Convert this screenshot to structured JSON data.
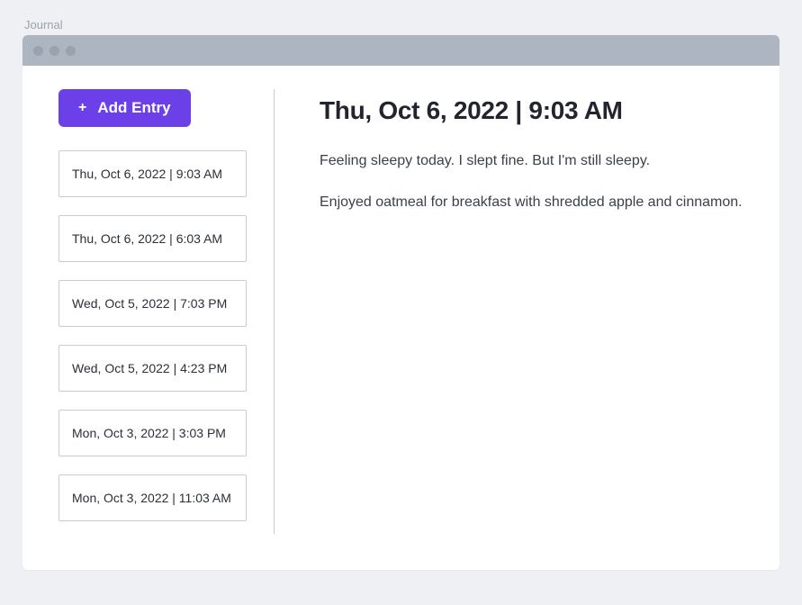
{
  "window": {
    "label": "Journal"
  },
  "sidebar": {
    "add_button_label": "Add Entry",
    "entries": [
      {
        "label": "Thu, Oct 6, 2022 | 9:03 AM"
      },
      {
        "label": "Thu, Oct 6, 2022 | 6:03 AM"
      },
      {
        "label": "Wed, Oct 5, 2022 | 7:03 PM"
      },
      {
        "label": "Wed, Oct 5, 2022 | 4:23 PM"
      },
      {
        "label": "Mon, Oct 3, 2022 | 3:03 PM"
      },
      {
        "label": "Mon, Oct 3, 2022 | 11:03 AM"
      }
    ]
  },
  "main": {
    "title": "Thu, Oct 6, 2022 | 9:03 AM",
    "paragraphs": [
      "Feeling sleepy today. I slept fine. But I'm still sleepy.",
      "Enjoyed oatmeal for breakfast with shredded apple and cinnamon."
    ]
  },
  "colors": {
    "accent": "#6b40e8"
  }
}
